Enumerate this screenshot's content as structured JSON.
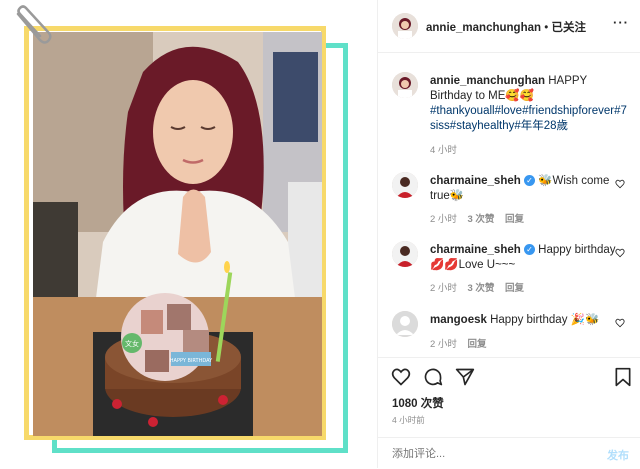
{
  "header": {
    "username": "annie_manchunghan",
    "separator": " • ",
    "follow_label": "已关注",
    "more_label": "···"
  },
  "caption": {
    "username": "annie_manchunghan",
    "text_plain": "HAPPY Birthday to ME🥰🥰",
    "hashtags": "#thankyouall#love#friendshipforever#7siss#stayhealthy#年年28歲",
    "time": "4 小时"
  },
  "comments": [
    {
      "username": "charmaine_sheh",
      "verified": "✓",
      "text": "🐝Wish come true🐝",
      "time": "2 小时",
      "likes": "3 次赞",
      "reply": "回复"
    },
    {
      "username": "charmaine_sheh",
      "verified": "✓",
      "text": "Happy birthday 💋💋Love U~~~",
      "time": "2 小时",
      "likes": "3 次赞",
      "reply": "回复"
    },
    {
      "username": "mangoesk",
      "text": "Happy birthday 🎉🐝",
      "time": "2 小时",
      "reply": "回复"
    }
  ],
  "actions": {
    "likes": "1080 次赞",
    "time": "4 小时前"
  },
  "composer": {
    "placeholder": "添加评论...",
    "post_label": "发布"
  },
  "photo": {
    "cake_label": "文女",
    "cake_card": "HAPPY BIRTHDAY"
  },
  "colors": {
    "frame_yellow": "#f7d96a",
    "frame_teal": "#5fe0c8",
    "link_blue": "#00376b",
    "post_blue": "#b2dffc",
    "verified_blue": "#3897f0"
  }
}
